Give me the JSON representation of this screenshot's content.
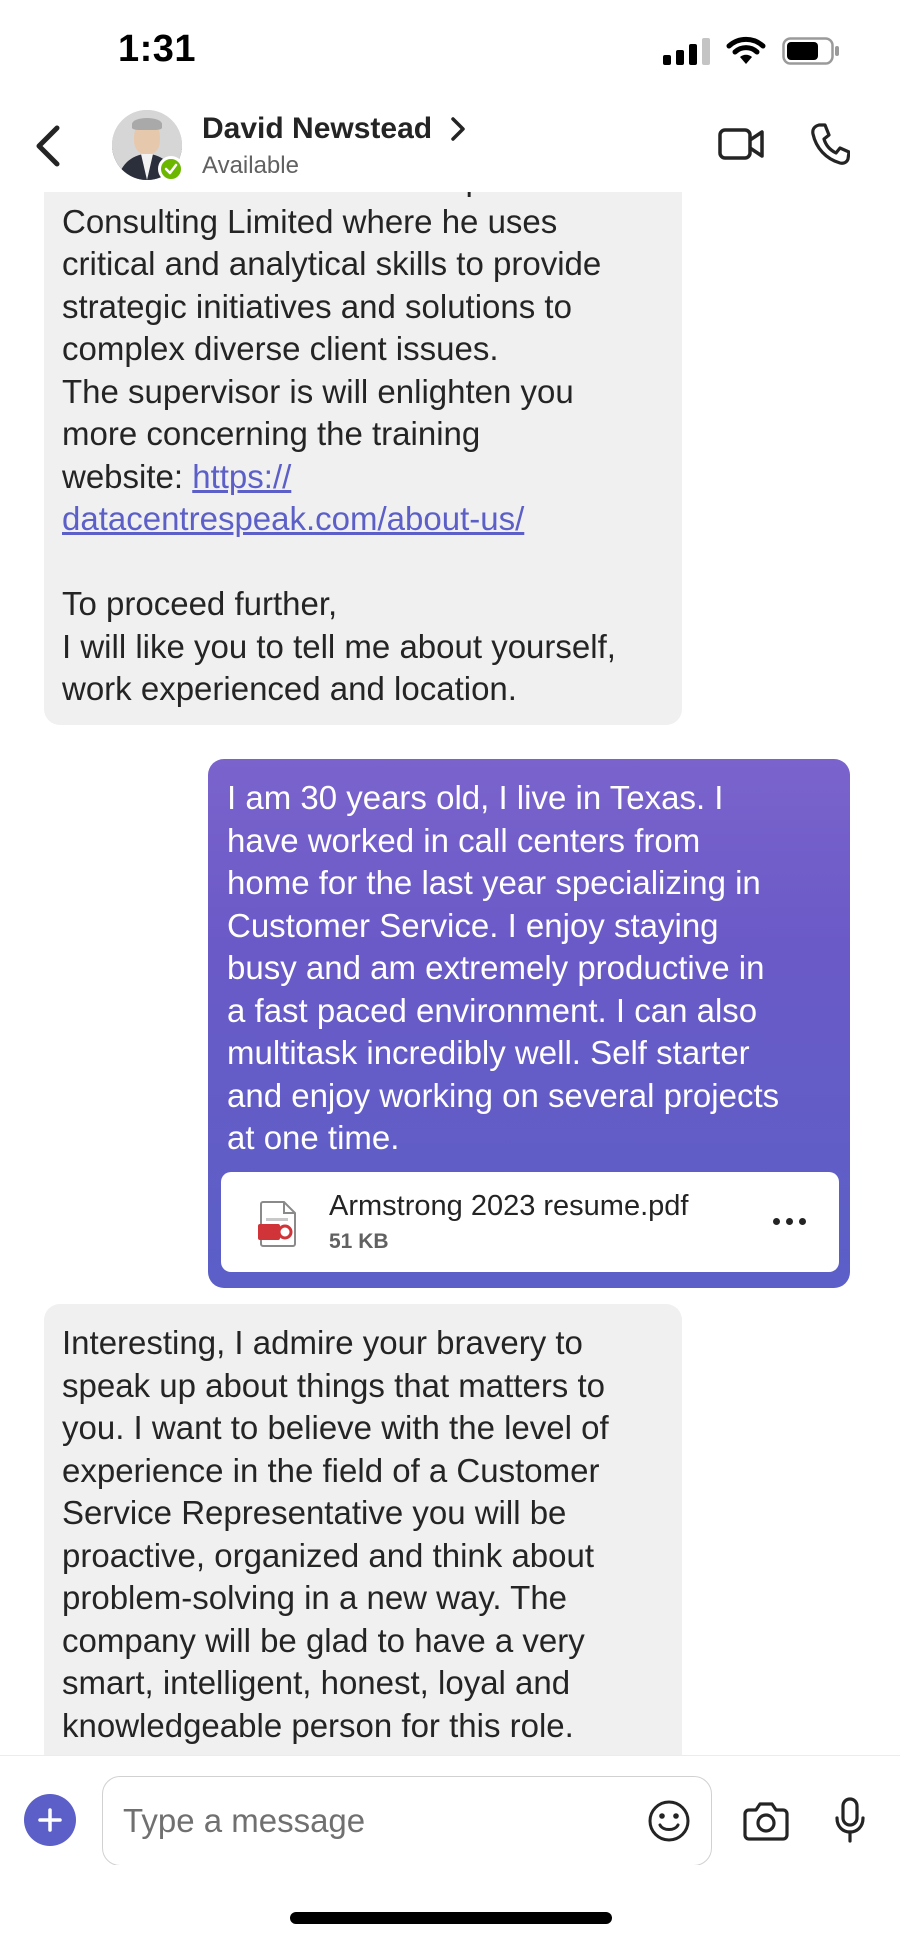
{
  "status_bar": {
    "time": "1:31"
  },
  "header": {
    "contact_name": "David Newstead",
    "contact_status": "Available",
    "presence_color": "#6bb700"
  },
  "messages": {
    "incoming_1": {
      "text_before_link": "of the team at Datacentre Speak\nConsulting Limited where he uses\ncritical and analytical skills to provide\nstrategic initiatives and solutions to\ncomplex diverse client issues.\nThe supervisor is will enlighten you\nmore concerning the training\nwebsite: ",
      "link_text": "https://\ndatacentrespeak.com/about-us/",
      "text_after_link": "\n\nTo proceed further,\nI will like you to tell me about yourself,\nwork experienced and location."
    },
    "outgoing_1": {
      "text": "I am 30 years old, I live in Texas. I\nhave worked in call centers from\nhome for the last year specializing in\nCustomer Service. I enjoy staying\nbusy and am extremely productive in\na fast paced environment. I can also\nmultitask incredibly well. Self starter\nand enjoy working on several projects\nat one time.",
      "attachment": {
        "file_name": "Armstrong 2023 resume.pdf",
        "file_size": "51 KB",
        "icon": "pdf-file-icon"
      }
    },
    "incoming_2": {
      "text": "Interesting, I admire your bravery to\nspeak up about things that matters to\nyou. I want to believe with the level of\nexperience in the field of a Customer\nService Representative you will be\nproactive, organized and think about\nproblem-solving in a new way. The\ncompany will be glad to have a very\nsmart, intelligent, honest, loyal and\nknowledgeable person for this role.\nHopefully you also have good work"
    }
  },
  "compose": {
    "placeholder": "Type a message"
  },
  "colors": {
    "accent": "#5b5fc7",
    "incoming_bubble": "#f0f0f0",
    "link": "#5b5fc7"
  }
}
